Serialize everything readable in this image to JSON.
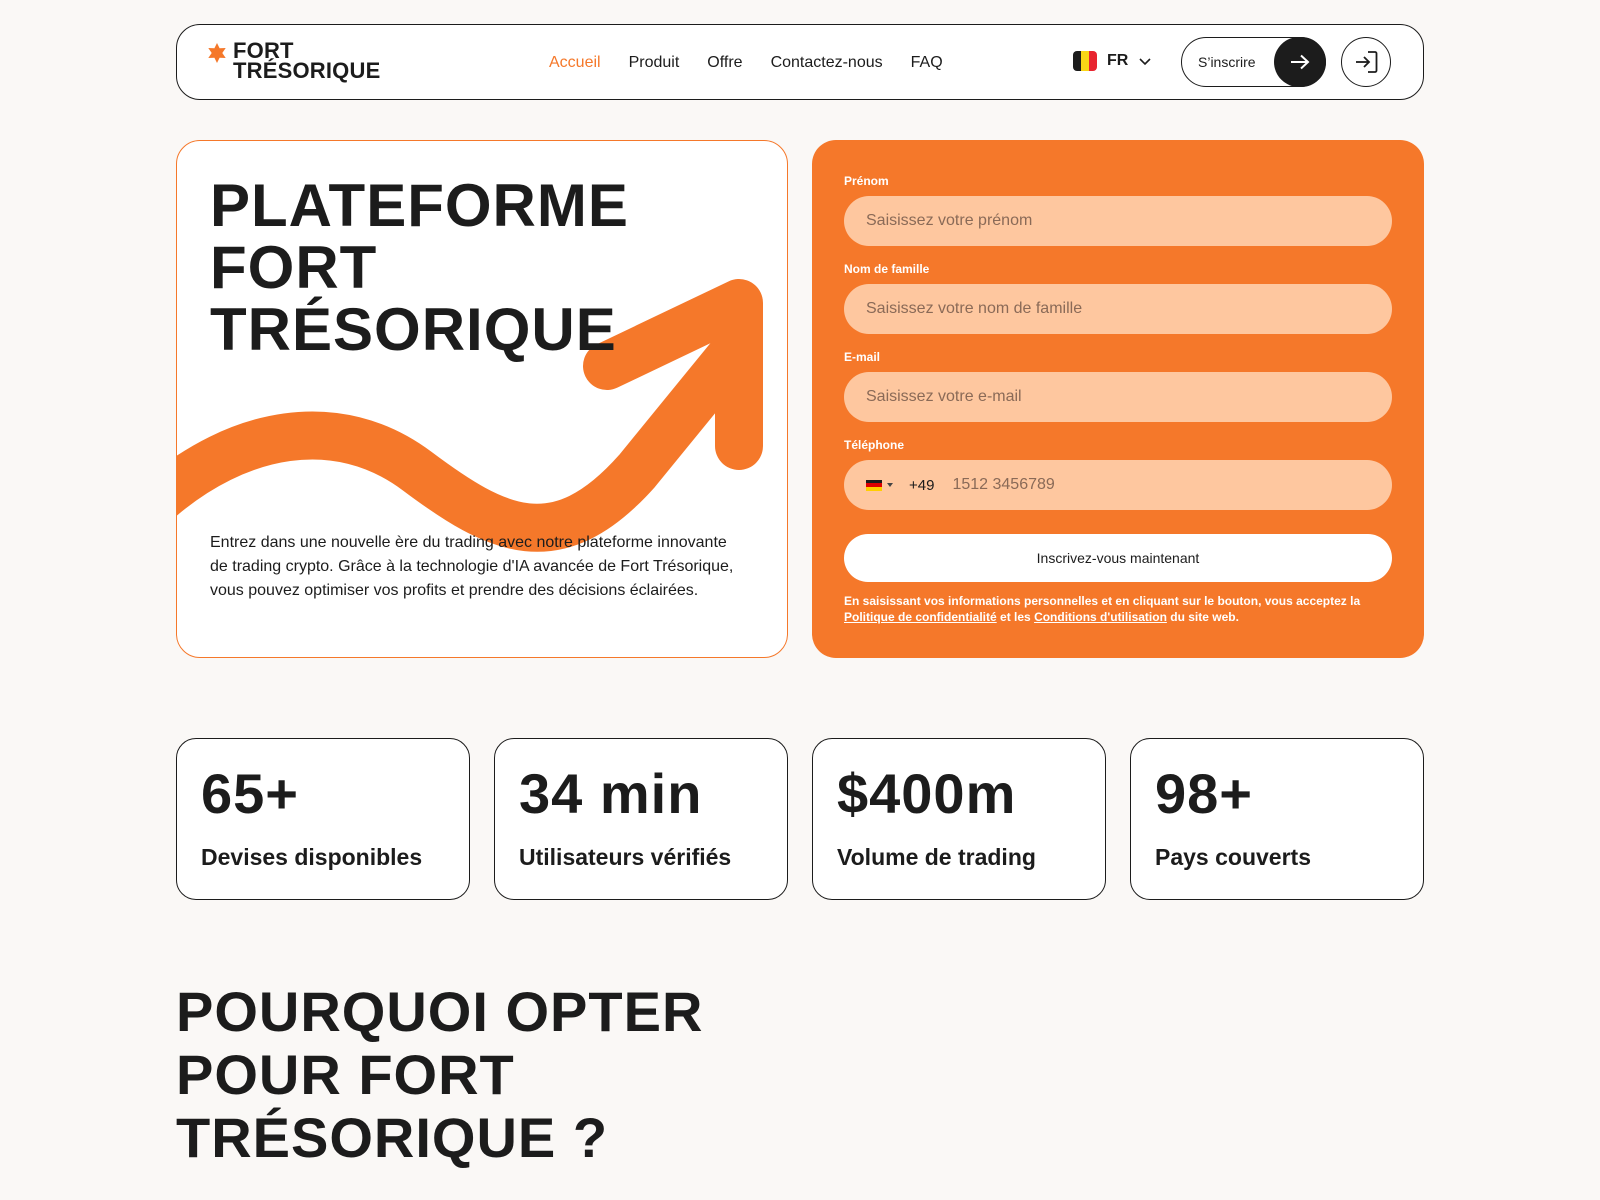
{
  "brand": {
    "name_line1": "FORT",
    "name_line2": "TRÉSORIQUE",
    "accent_color": "#f5782a",
    "dark_color": "#1c1c1c",
    "logo_icon": "star-icon"
  },
  "nav": {
    "items": [
      {
        "label": "Accueil",
        "active": true
      },
      {
        "label": "Produit",
        "active": false
      },
      {
        "label": "Offre",
        "active": false
      },
      {
        "label": "Contactez-nous",
        "active": false
      },
      {
        "label": "FAQ",
        "active": false
      }
    ]
  },
  "language": {
    "code": "FR",
    "flag": "belgium-flag-icon"
  },
  "header_actions": {
    "signup_label": "S’inscrire",
    "signup_icon": "arrow-right-icon",
    "login_icon": "login-icon"
  },
  "hero": {
    "title_line1": "PLATEFORME",
    "title_line2": "FORT",
    "title_line3": "TRÉSORIQUE",
    "description": "Entrez dans une nouvelle ère du trading avec notre plateforme innovante de trading crypto. Grâce à la technologie d'IA avancée de Fort Trésorique, vous pouvez optimiser vos profits et prendre des décisions éclairées."
  },
  "form": {
    "first_name": {
      "label": "Prénom",
      "placeholder": "Saisissez votre prénom"
    },
    "last_name": {
      "label": "Nom de famille",
      "placeholder": "Saisissez votre nom de famille"
    },
    "email": {
      "label": "E-mail",
      "placeholder": "Saisissez votre e-mail"
    },
    "phone": {
      "label": "Téléphone",
      "dial_code": "+49",
      "placeholder": "1512 3456789",
      "flag": "germany-flag-icon"
    },
    "submit_label": "Inscrivez-vous maintenant",
    "legal_prefix": "En saisissant vos informations personnelles et en cliquant sur le bouton, vous acceptez la",
    "privacy_link": "Politique de confidentialité",
    "legal_and": "et les",
    "terms_link": "Conditions d'utilisation",
    "legal_suffix": "du site web."
  },
  "stats": [
    {
      "value": "65+",
      "label": "Devises disponibles"
    },
    {
      "value": "34 min",
      "label": "Utilisateurs vérifiés"
    },
    {
      "value": "$400m",
      "label": "Volume de trading"
    },
    {
      "value": "98+",
      "label": "Pays couverts"
    }
  ],
  "why_section": {
    "title_line1": "POURQUOI OPTER",
    "title_line2": "POUR FORT",
    "title_line3": "TRÉSORIQUE ?"
  }
}
